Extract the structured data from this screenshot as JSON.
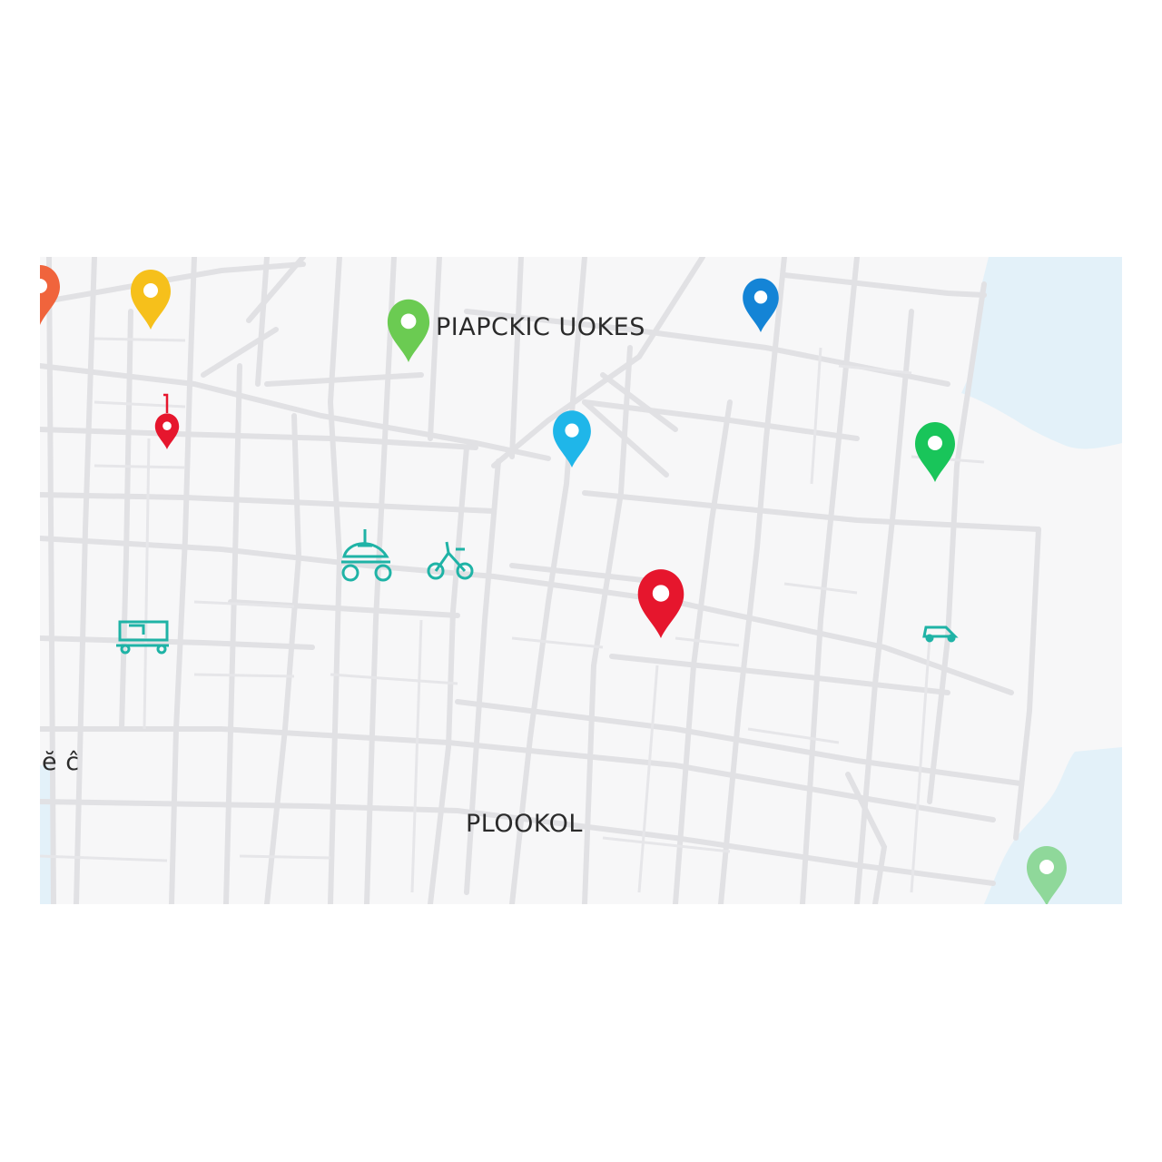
{
  "map": {
    "labels": {
      "district_top": "PIAPCKIC UOKES",
      "district_bottom": "PLOOKOL",
      "edge_fragment": "ĕ ĉ"
    },
    "colors": {
      "land": "#f7f7f8",
      "water": "#e3f1f9",
      "road": "#e1e1e4",
      "transit_icon": "#1fb3a6",
      "pin_red": "#e6162d",
      "pin_yellow": "#f6c01b",
      "pin_green": "#6bcb52",
      "pin_green_dark": "#19c55a",
      "pin_blue": "#1484d6",
      "pin_cyan": "#1fb6e9",
      "pin_orange": "#f0643c",
      "pin_pale_green": "#8fd89a"
    },
    "pins": [
      {
        "name": "orange-pin",
        "icon": "map-pin-icon",
        "color": "#f0643c"
      },
      {
        "name": "yellow-pin",
        "icon": "map-pin-icon",
        "color": "#f6c01b"
      },
      {
        "name": "green-pin",
        "icon": "map-pin-icon",
        "color": "#6bcb52"
      },
      {
        "name": "blue-pin",
        "icon": "map-pin-icon",
        "color": "#1484d6"
      },
      {
        "name": "red-small-pin",
        "icon": "map-pin-icon",
        "color": "#e6162d"
      },
      {
        "name": "cyan-pin",
        "icon": "map-pin-icon",
        "color": "#1fb6e9"
      },
      {
        "name": "dark-green-pin",
        "icon": "map-pin-icon",
        "color": "#19c55a"
      },
      {
        "name": "red-pin",
        "icon": "map-pin-icon",
        "color": "#e6162d"
      },
      {
        "name": "pale-green-pin",
        "icon": "map-pin-icon",
        "color": "#8fd89a"
      }
    ],
    "transit_icons": [
      "carriage-icon",
      "bicycle-icon",
      "tram-icon",
      "car-icon"
    ]
  }
}
